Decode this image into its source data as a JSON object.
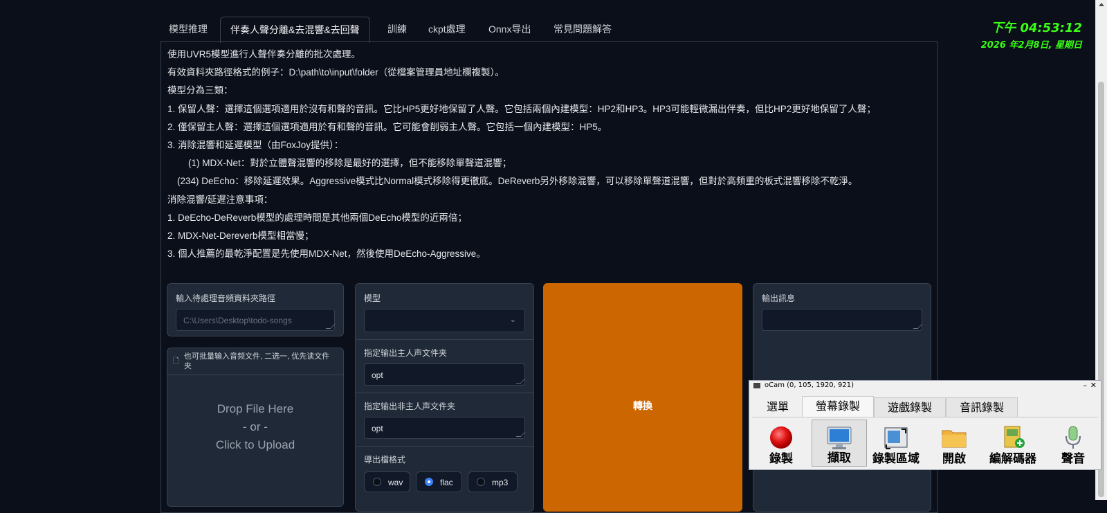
{
  "tabs": [
    "模型推理",
    "伴奏人聲分離&去混響&去回聲",
    "訓練",
    "ckpt處理",
    "Onnx导出",
    "常見問題解答"
  ],
  "active_tab_index": 1,
  "description": [
    "使用UVR5模型進行人聲伴奏分離的批次處理。",
    "有效資料夾路徑格式的例子：D:\\path\\to\\input\\folder（從檔案管理員地址欄複製）。",
    "模型分為三類：",
    "1. 保留人聲：選擇這個選項適用於沒有和聲的音訊。它比HP5更好地保留了人聲。它包括兩個內建模型：HP2和HP3。HP3可能輕微漏出伴奏，但比HP2更好地保留了人聲；",
    "2. 僅保留主人聲：選擇這個選項適用於有和聲的音訊。它可能會削弱主人聲。它包括一個內建模型：HP5。",
    "3. 消除混響和延遲模型（由FoxJoy提供）：",
    "(1) MDX-Net：對於立體聲混響的移除是最好的選擇，但不能移除單聲道混響；",
    "(234) DeEcho：移除延遲效果。Aggressive模式比Normal模式移除得更徹底。DeReverb另外移除混響，可以移除單聲道混響，但對於高頻重的板式混響移除不乾淨。",
    "消除混響/延遲注意事項：",
    "1. DeEcho-DeReverb模型的處理時間是其他兩個DeEcho模型的近兩倍；",
    "2. MDX-Net-Dereverb模型相當慢；",
    "3. 個人推薦的最乾淨配置是先使用MDX-Net，然後使用DeEcho-Aggressive。"
  ],
  "input_dir": {
    "label": "輸入待處理音頻資料夾路徑",
    "placeholder": "C:\\Users\\Desktop\\todo-songs"
  },
  "upload": {
    "label": "也可批量输入音频文件, 二选一, 优先读文件夹",
    "drop_line1": "Drop File Here",
    "drop_line2": "- or -",
    "drop_line3": "Click to Upload"
  },
  "model": {
    "label": "模型",
    "value": ""
  },
  "vocal_out": {
    "label": "指定输出主人声文件夹",
    "value": "opt"
  },
  "inst_out": {
    "label": "指定输出非主人声文件夹",
    "value": "opt"
  },
  "format": {
    "label": "導出檔格式",
    "options": [
      "wav",
      "flac",
      "mp3"
    ],
    "selected": "flac"
  },
  "convert_button": "轉換",
  "output": {
    "label": "輸出訊息",
    "value": ""
  },
  "clock": {
    "time": "下午 04:53:12",
    "date": "2026 年2月8日, 星期日"
  },
  "ocam": {
    "title": "oCam (0, 105, 1920, 921)",
    "tabs": [
      "選單",
      "螢幕錄製",
      "遊戲錄製",
      "音訊錄製"
    ],
    "active_tab": "螢幕錄製",
    "tools": [
      "錄製",
      "擷取",
      "錄製區域",
      "開啟",
      "編解碼器",
      "聲音"
    ],
    "active_tool": "擷取"
  },
  "colors": {
    "background": "#0b0f19",
    "panel": "#1f2937",
    "accent_orange": "#cc6600",
    "clock_green": "#39ff14",
    "radio_selected": "#3b82f6"
  }
}
